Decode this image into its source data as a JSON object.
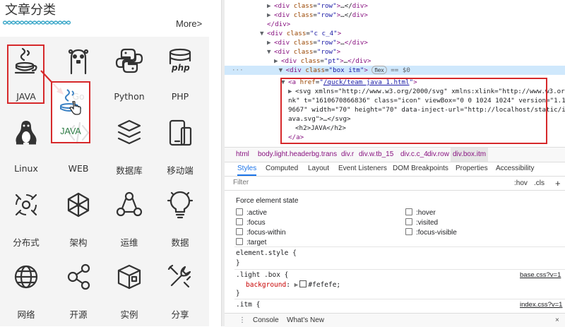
{
  "left": {
    "title": "文章分类",
    "more": "More>",
    "categories": [
      {
        "label": "JAVA",
        "icon": "java-icon"
      },
      {
        "label": "Go",
        "icon": "gopher-icon"
      },
      {
        "label": "Python",
        "icon": "python-icon"
      },
      {
        "label": "PHP",
        "icon": "php-icon"
      },
      {
        "label": "Linux",
        "icon": "linux-icon"
      },
      {
        "label": "WEB",
        "icon": "web-icon"
      },
      {
        "label": "数据库",
        "icon": "database-icon"
      },
      {
        "label": "移动端",
        "icon": "mobile-icon"
      },
      {
        "label": "分布式",
        "icon": "distributed-icon"
      },
      {
        "label": "架构",
        "icon": "architecture-icon"
      },
      {
        "label": "运维",
        "icon": "ops-icon"
      },
      {
        "label": "数据",
        "icon": "data-icon"
      },
      {
        "label": "网络",
        "icon": "network-icon"
      },
      {
        "label": "开源",
        "icon": "opensource-icon"
      },
      {
        "label": "实例",
        "icon": "example-icon"
      },
      {
        "label": "分享",
        "icon": "share-icon"
      }
    ],
    "drag_label": "JAVA",
    "accent": "#d6292b"
  },
  "devtools": {
    "dom": {
      "l1a": "div",
      "l1b": "class",
      "l1c": "row",
      "l1d": "…</",
      "l2a": "div",
      "l2b": "class",
      "l2c": "row",
      "l2d": "…</",
      "l3": "</div>",
      "l4a": "div",
      "l4b": "class",
      "l4c": "c c_4",
      "l5a": "div",
      "l5b": "class",
      "l5c": "row",
      "l6a": "div",
      "l6b": "class",
      "l6c": "row",
      "l7a": "div",
      "l7b": "class",
      "l7c": "pt",
      "l8a": "div",
      "l8b": "class",
      "l8c": "box itm",
      "l8flex": "flex",
      "l8eq": "== $0",
      "l9a": "a",
      "l9b": "href",
      "l9c": "/quck/team_java_1.html",
      "l10": "<svg xmlns=\"http://www.w3.org/2000/svg\" xmlns:xlink=\"http://www.w3.org/1999",
      "l11": "nk\" t=\"1610670866836\" class=\"icon\" viewBox=\"0 0 1024 1024\" version=\"1.1\" p-i",
      "l12": "9667\" width=\"70\" height=\"70\" data-inject-url=\"http://localhost/static/img/te",
      "l13": "ava.svg\">…</svg>",
      "l14": "<h2>JAVA</h2>",
      "l15": "</a>"
    },
    "breadcrumbs": [
      "html",
      "body.light.headerbg.trans",
      "div.r",
      "div.w.tb_15",
      "div.c.c_4",
      "div.row",
      "div.box.itm"
    ],
    "tabs": [
      "Styles",
      "Computed",
      "Layout",
      "Event Listeners",
      "DOM Breakpoints",
      "Properties",
      "Accessibility"
    ],
    "filter_placeholder": "Filter",
    "hov": ":hov",
    "cls": ".cls",
    "plus": "+",
    "force_state_title": "Force element state",
    "states": [
      ":active",
      ":hover",
      ":focus",
      ":visited",
      ":focus-within",
      ":focus-visible",
      ":target"
    ],
    "rule1_selector": "element.style {",
    "brace_close": "}",
    "rule2_selector": ".light .box {",
    "rule2_source": "base.css?v=1",
    "rule2_prop": "background",
    "rule2_value": "#fefefe;",
    "rule2_color": "#fefefe",
    "rule3_selector": ".itm {",
    "rule3_source": "index.css?v=1",
    "console_menu": "⋮",
    "console_tabs": [
      "Console",
      "What's New"
    ],
    "console_close": "×"
  }
}
